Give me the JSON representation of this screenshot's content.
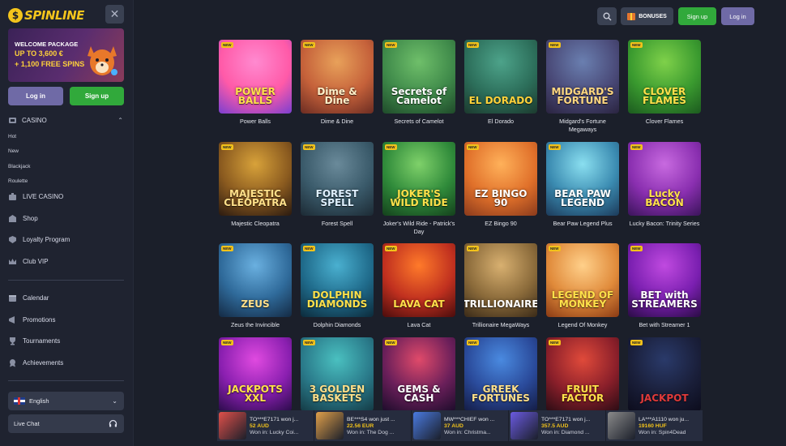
{
  "brand": {
    "logo_text": "SPINLINE"
  },
  "header": {
    "bonuses_label": "BONUSES",
    "signup_label": "Sign up",
    "login_label": "Log in"
  },
  "sidebar": {
    "promo": {
      "line1": "WELCOME PACKAGE",
      "line2": "UP TO 3,600 €",
      "line3": "+ 1,100 FREE SPINS"
    },
    "login_label": "Log in",
    "signup_label": "Sign up",
    "casino": {
      "label": "CASINO",
      "sub_items": [
        "Hot",
        "New",
        "Blackjack",
        "Roulette"
      ]
    },
    "items": [
      {
        "label": "LIVE CASINO",
        "icon": "live-casino-icon"
      },
      {
        "label": "Shop",
        "icon": "shop-icon"
      },
      {
        "label": "Loyalty Program",
        "icon": "loyalty-icon"
      },
      {
        "label": "Club VIP",
        "icon": "crown-icon"
      },
      {
        "label": "Calendar",
        "icon": "calendar-icon"
      },
      {
        "label": "Promotions",
        "icon": "promotions-icon"
      },
      {
        "label": "Tournaments",
        "icon": "trophy-icon"
      },
      {
        "label": "Achievements",
        "icon": "achievements-icon"
      }
    ],
    "language": "English",
    "live_chat": "Live Chat"
  },
  "new_badge": "NEW",
  "games": [
    {
      "name": "Power Balls",
      "art": "POWER BALLS",
      "colors": [
        "#ff8ad0",
        "#ff5aa8",
        "#7a3fd0"
      ],
      "text_color": "#ffe14a"
    },
    {
      "name": "Dime & Dine",
      "art": "Dime & Dine",
      "colors": [
        "#e8a15a",
        "#c5613a",
        "#6b2c22"
      ],
      "text_color": "#fff0c9"
    },
    {
      "name": "Secrets of Camelot",
      "art": "Secrets of Camelot",
      "colors": [
        "#6fbf6a",
        "#3f8a4a",
        "#1f4a2a"
      ],
      "text_color": "#ffffff"
    },
    {
      "name": "El Dorado",
      "art": "EL DORADO",
      "colors": [
        "#4da38a",
        "#2c6e5a",
        "#1c3a2e"
      ],
      "text_color": "#ffd23a"
    },
    {
      "name": "Midgard's Fortune Megaways",
      "art": "MIDGARD'S FORTUNE",
      "colors": [
        "#6a7fb0",
        "#4a4a78",
        "#2a2440"
      ],
      "text_color": "#ffd780"
    },
    {
      "name": "Clover Flames",
      "art": "CLOVER FLAMES",
      "colors": [
        "#7fd14a",
        "#3a9a2f",
        "#1c5a1f"
      ],
      "text_color": "#ffe14a"
    },
    {
      "name": "Majestic Cleopatra",
      "art": "MAJESTIC CLEOPATRA",
      "colors": [
        "#d8a23a",
        "#8a5a1f",
        "#2a1a10"
      ],
      "text_color": "#ffe08a"
    },
    {
      "name": "Forest Spell",
      "art": "FOREST SPELL",
      "colors": [
        "#6a8a9a",
        "#3a5a6a",
        "#1c2a34"
      ],
      "text_color": "#dff0ff"
    },
    {
      "name": "Joker's Wild Ride - Patrick's Day",
      "art": "JOKER'S WILD RIDE",
      "colors": [
        "#7fd16a",
        "#2f8a3a",
        "#14401c"
      ],
      "text_color": "#ffe14a"
    },
    {
      "name": "EZ Bingo 90",
      "art": "EZ BINGO 90",
      "colors": [
        "#ffb15a",
        "#e0702a",
        "#8a3a1c"
      ],
      "text_color": "#ffffff"
    },
    {
      "name": "Bear Paw Legend Plus",
      "art": "BEAR PAW LEGEND",
      "colors": [
        "#8adff0",
        "#3a8ab0",
        "#1c3a5a"
      ],
      "text_color": "#ffffff"
    },
    {
      "name": "Lucky Bacon: Trinity Series",
      "art": "Lucky BACON",
      "colors": [
        "#c86ae0",
        "#8a2fb0",
        "#3a145a"
      ],
      "text_color": "#ffe14a"
    },
    {
      "name": "Zeus the Invincible",
      "art": "ZEUS",
      "colors": [
        "#6ab0e0",
        "#2f6a9a",
        "#142a44"
      ],
      "text_color": "#ffe08a"
    },
    {
      "name": "Dolphin Diamonds",
      "art": "DOLPHIN DIAMONDS",
      "colors": [
        "#4ab0d0",
        "#1f6a8a",
        "#0c2a3a"
      ],
      "text_color": "#ffe14a"
    },
    {
      "name": "Lava Cat",
      "art": "LAVA CAT",
      "colors": [
        "#ff7a2a",
        "#c0301f",
        "#4a0c0c"
      ],
      "text_color": "#ffe14a"
    },
    {
      "name": "Trillionaire MegaWays",
      "art": "TRILLIONAIRE",
      "colors": [
        "#d8b070",
        "#8a6a3a",
        "#3a2a18"
      ],
      "text_color": "#ffffff"
    },
    {
      "name": "Legend Of Monkey",
      "art": "LEGEND OF MONKEY",
      "colors": [
        "#ffd08a",
        "#e08a3a",
        "#8a3a14"
      ],
      "text_color": "#ffe14a"
    },
    {
      "name": "Bet with Streamer 1",
      "art": "BET with STREAMERS",
      "colors": [
        "#c04ae0",
        "#7a1fb0",
        "#2a0c44"
      ],
      "text_color": "#ffffff"
    },
    {
      "name": "",
      "art": "JACKPOTS XXL",
      "colors": [
        "#e04ae0",
        "#8a1fb0",
        "#2a0c4a"
      ],
      "text_color": "#ffe14a"
    },
    {
      "name": "",
      "art": "3 GOLDEN BASKETS",
      "colors": [
        "#4ac0c0",
        "#2a7a8a",
        "#143a44"
      ],
      "text_color": "#ffe08a"
    },
    {
      "name": "",
      "art": "GEMS & CASH",
      "colors": [
        "#e04a6a",
        "#6a1f5a",
        "#1c0c2a"
      ],
      "text_color": "#ffffff"
    },
    {
      "name": "",
      "art": "GREEK FORTUNES",
      "colors": [
        "#4a8ae0",
        "#2a4a9a",
        "#141c44"
      ],
      "text_color": "#ffe08a"
    },
    {
      "name": "",
      "art": "FRUIT FACTOR",
      "colors": [
        "#e04a3a",
        "#8a1f2a",
        "#2a0c14"
      ],
      "text_color": "#ffe14a"
    },
    {
      "name": "",
      "art": "JACKPOT",
      "colors": [
        "#2a3a6a",
        "#1a1f3a",
        "#0c0c1c"
      ],
      "text_color": "#e03a3a"
    }
  ],
  "winners": [
    {
      "user": "TO***E7171 won j...",
      "amount": "52 AUD",
      "game": "Won in: Lucky Coi...",
      "color": "#e0504a"
    },
    {
      "user": "BE***S4 won just ...",
      "amount": "22.56 EUR",
      "game": "Won in: The Dog ...",
      "color": "#e0a04a"
    },
    {
      "user": "MW***CHIEF won ...",
      "amount": "37 AUD",
      "game": "Won in: Christma...",
      "color": "#4a7ae0"
    },
    {
      "user": "TO***E7171 won j...",
      "amount": "357.5 AUD",
      "game": "Won in: Diamond ...",
      "color": "#6a5ae0"
    },
    {
      "user": "LA***A1110 won ju...",
      "amount": "19160 HUF",
      "game": "Won in: Spin4Dead",
      "color": "#8a8a8a"
    }
  ]
}
